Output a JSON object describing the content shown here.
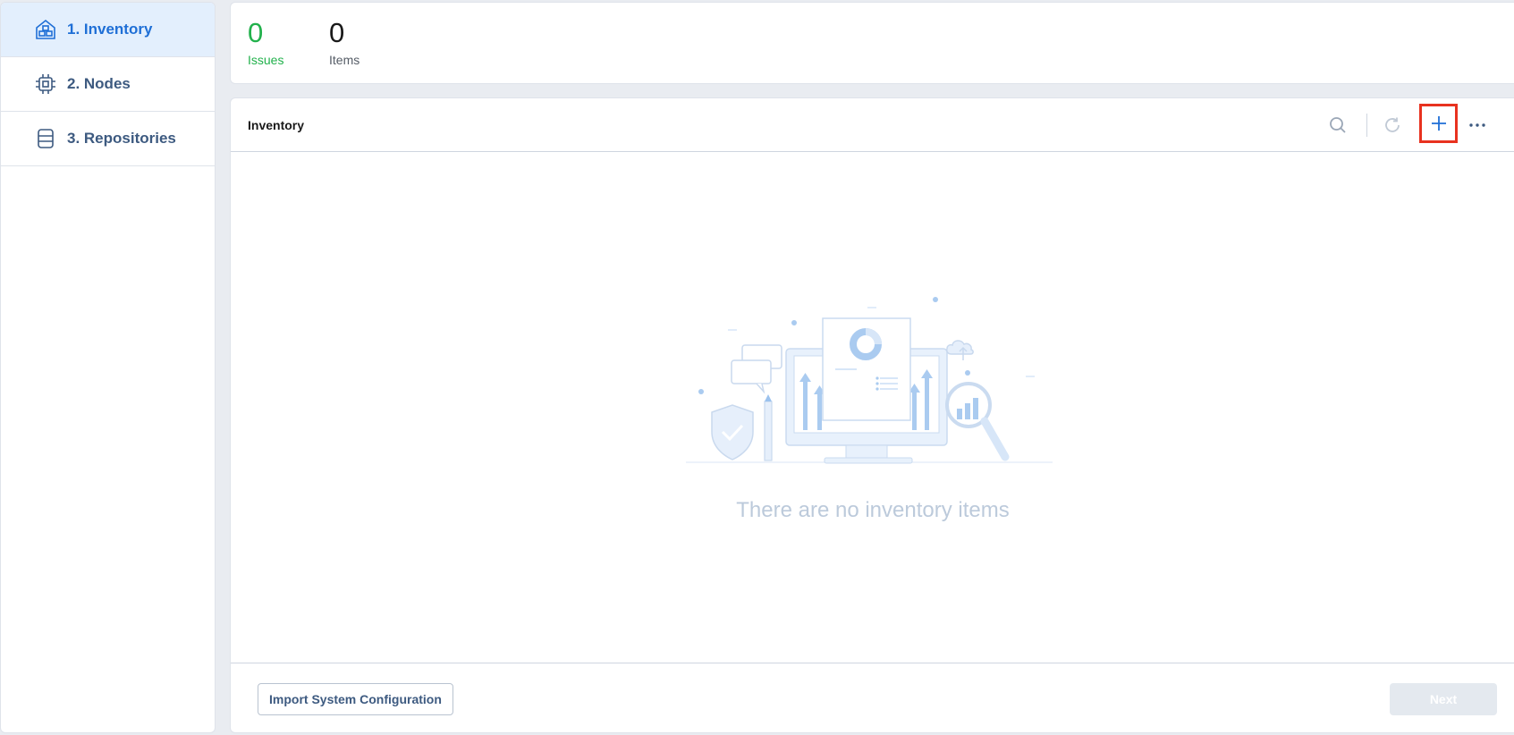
{
  "sidebar": {
    "items": [
      {
        "label": "1. Inventory",
        "icon": "inventory-icon",
        "active": true
      },
      {
        "label": "2. Nodes",
        "icon": "chip-icon",
        "active": false
      },
      {
        "label": "3. Repositories",
        "icon": "database-icon",
        "active": false
      }
    ]
  },
  "stats": {
    "issues": {
      "value": "0",
      "label": "Issues"
    },
    "items": {
      "value": "0",
      "label": "Items"
    }
  },
  "panel": {
    "title": "Inventory",
    "empty_message": "There are no inventory items"
  },
  "footer": {
    "import_label": "Import System Configuration",
    "next_label": "Next"
  },
  "colors": {
    "accent": "#1f6fd6",
    "success": "#22b14c",
    "highlight": "#e8321f"
  }
}
